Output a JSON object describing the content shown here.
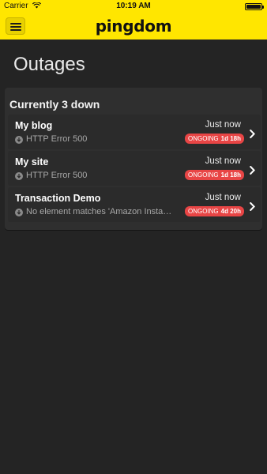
{
  "status_bar": {
    "carrier": "Carrier",
    "time": "10:19 AM"
  },
  "nav": {
    "logo": "pingdom",
    "brand_color": "#ffe600"
  },
  "page": {
    "title": "Outages"
  },
  "summary": {
    "header": "Currently 3 down"
  },
  "outages": [
    {
      "name": "My blog",
      "error": "HTTP Error 500",
      "when": "Just now",
      "status": "ONGOING",
      "duration": "1d 18h"
    },
    {
      "name": "My site",
      "error": "HTTP Error 500",
      "when": "Just now",
      "status": "ONGOING",
      "duration": "1d 18h"
    },
    {
      "name": "Transaction Demo",
      "error": "No element matches 'Amazon Insta…",
      "when": "Just now",
      "status": "ONGOING",
      "duration": "4d 20h"
    }
  ],
  "colors": {
    "background": "#242424",
    "badge": "#e84545"
  },
  "icons": {
    "menu": "hamburger-menu-icon",
    "error": "down-arrow-circle-icon",
    "chevron": "chevron-right-icon"
  }
}
